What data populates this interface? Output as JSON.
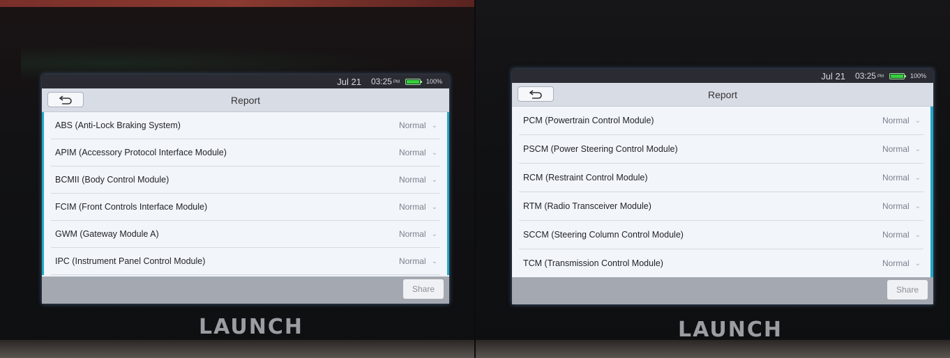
{
  "screens": [
    {
      "status": {
        "date": "Jul 21",
        "time": "03:25",
        "ampm": "PM",
        "battery": "100%"
      },
      "title": "Report",
      "share_label": "Share",
      "brand": "LAUNCH",
      "rows": [
        {
          "label": "ABS (Anti-Lock Braking System)",
          "status": "Normal"
        },
        {
          "label": "APIM (Accessory Protocol Interface Module)",
          "status": "Normal"
        },
        {
          "label": "BCMII (Body Control Module)",
          "status": "Normal"
        },
        {
          "label": "FCIM (Front Controls Interface Module)",
          "status": "Normal"
        },
        {
          "label": "GWM (Gateway Module A)",
          "status": "Normal"
        },
        {
          "label": "IPC (Instrument Panel Control Module)",
          "status": "Normal"
        }
      ]
    },
    {
      "status": {
        "date": "Jul 21",
        "time": "03:25",
        "ampm": "PM",
        "battery": "100%"
      },
      "title": "Report",
      "share_label": "Share",
      "brand": "LAUNCH",
      "rows": [
        {
          "label": "PCM (Powertrain Control Module)",
          "status": "Normal"
        },
        {
          "label": "PSCM (Power Steering Control Module)",
          "status": "Normal"
        },
        {
          "label": "RCM (Restraint Control Module)",
          "status": "Normal"
        },
        {
          "label": "RTM (Radio Transceiver Module)",
          "status": "Normal"
        },
        {
          "label": "SCCM (Steering Column Control Module)",
          "status": "Normal"
        },
        {
          "label": "TCM (Transmission Control Module)",
          "status": "Normal"
        }
      ]
    }
  ],
  "colors": {
    "accent": "#21a7c8",
    "statusbar": "#2b2c33",
    "battery": "#32d23a"
  },
  "icons": {
    "back": "back-arrow-icon",
    "chevron": "chevron-down-icon",
    "battery": "battery-icon"
  }
}
